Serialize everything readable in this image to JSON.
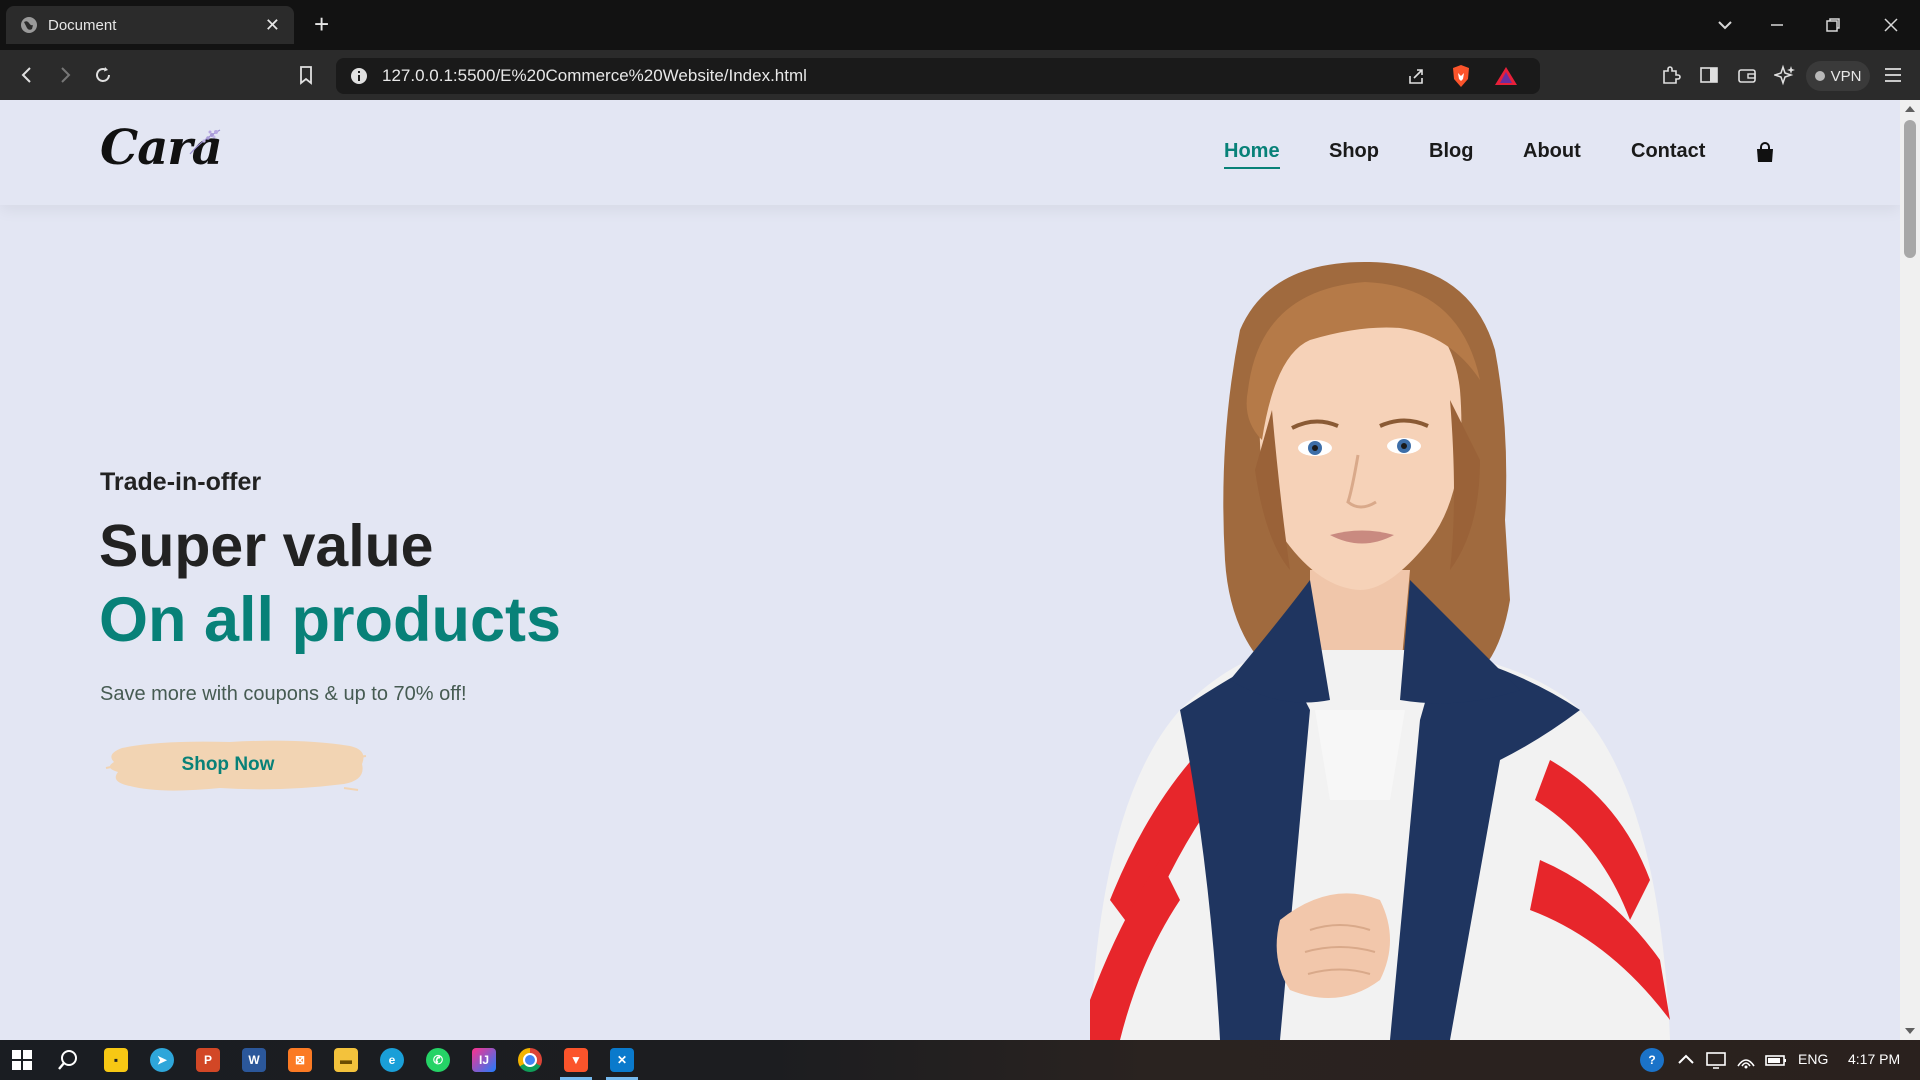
{
  "browser": {
    "tab_title": "Document",
    "address": "127.0.0.1:5500/E%20Commerce%20Website/Index.html",
    "vpn_label": "VPN"
  },
  "site": {
    "logo_text": "Cara",
    "nav": [
      "Home",
      "Shop",
      "Blog",
      "About",
      "Contact"
    ],
    "active_nav": "Home",
    "accent_color": "#088178",
    "hero": {
      "offer": "Trade-in-offer",
      "headline": "Super value",
      "headline_accent": "On all products",
      "subtext": "Save more with coupons & up to 70% off!",
      "cta": "Shop Now"
    }
  },
  "taskbar": {
    "language": "ENG",
    "time": "4:17 PM"
  }
}
